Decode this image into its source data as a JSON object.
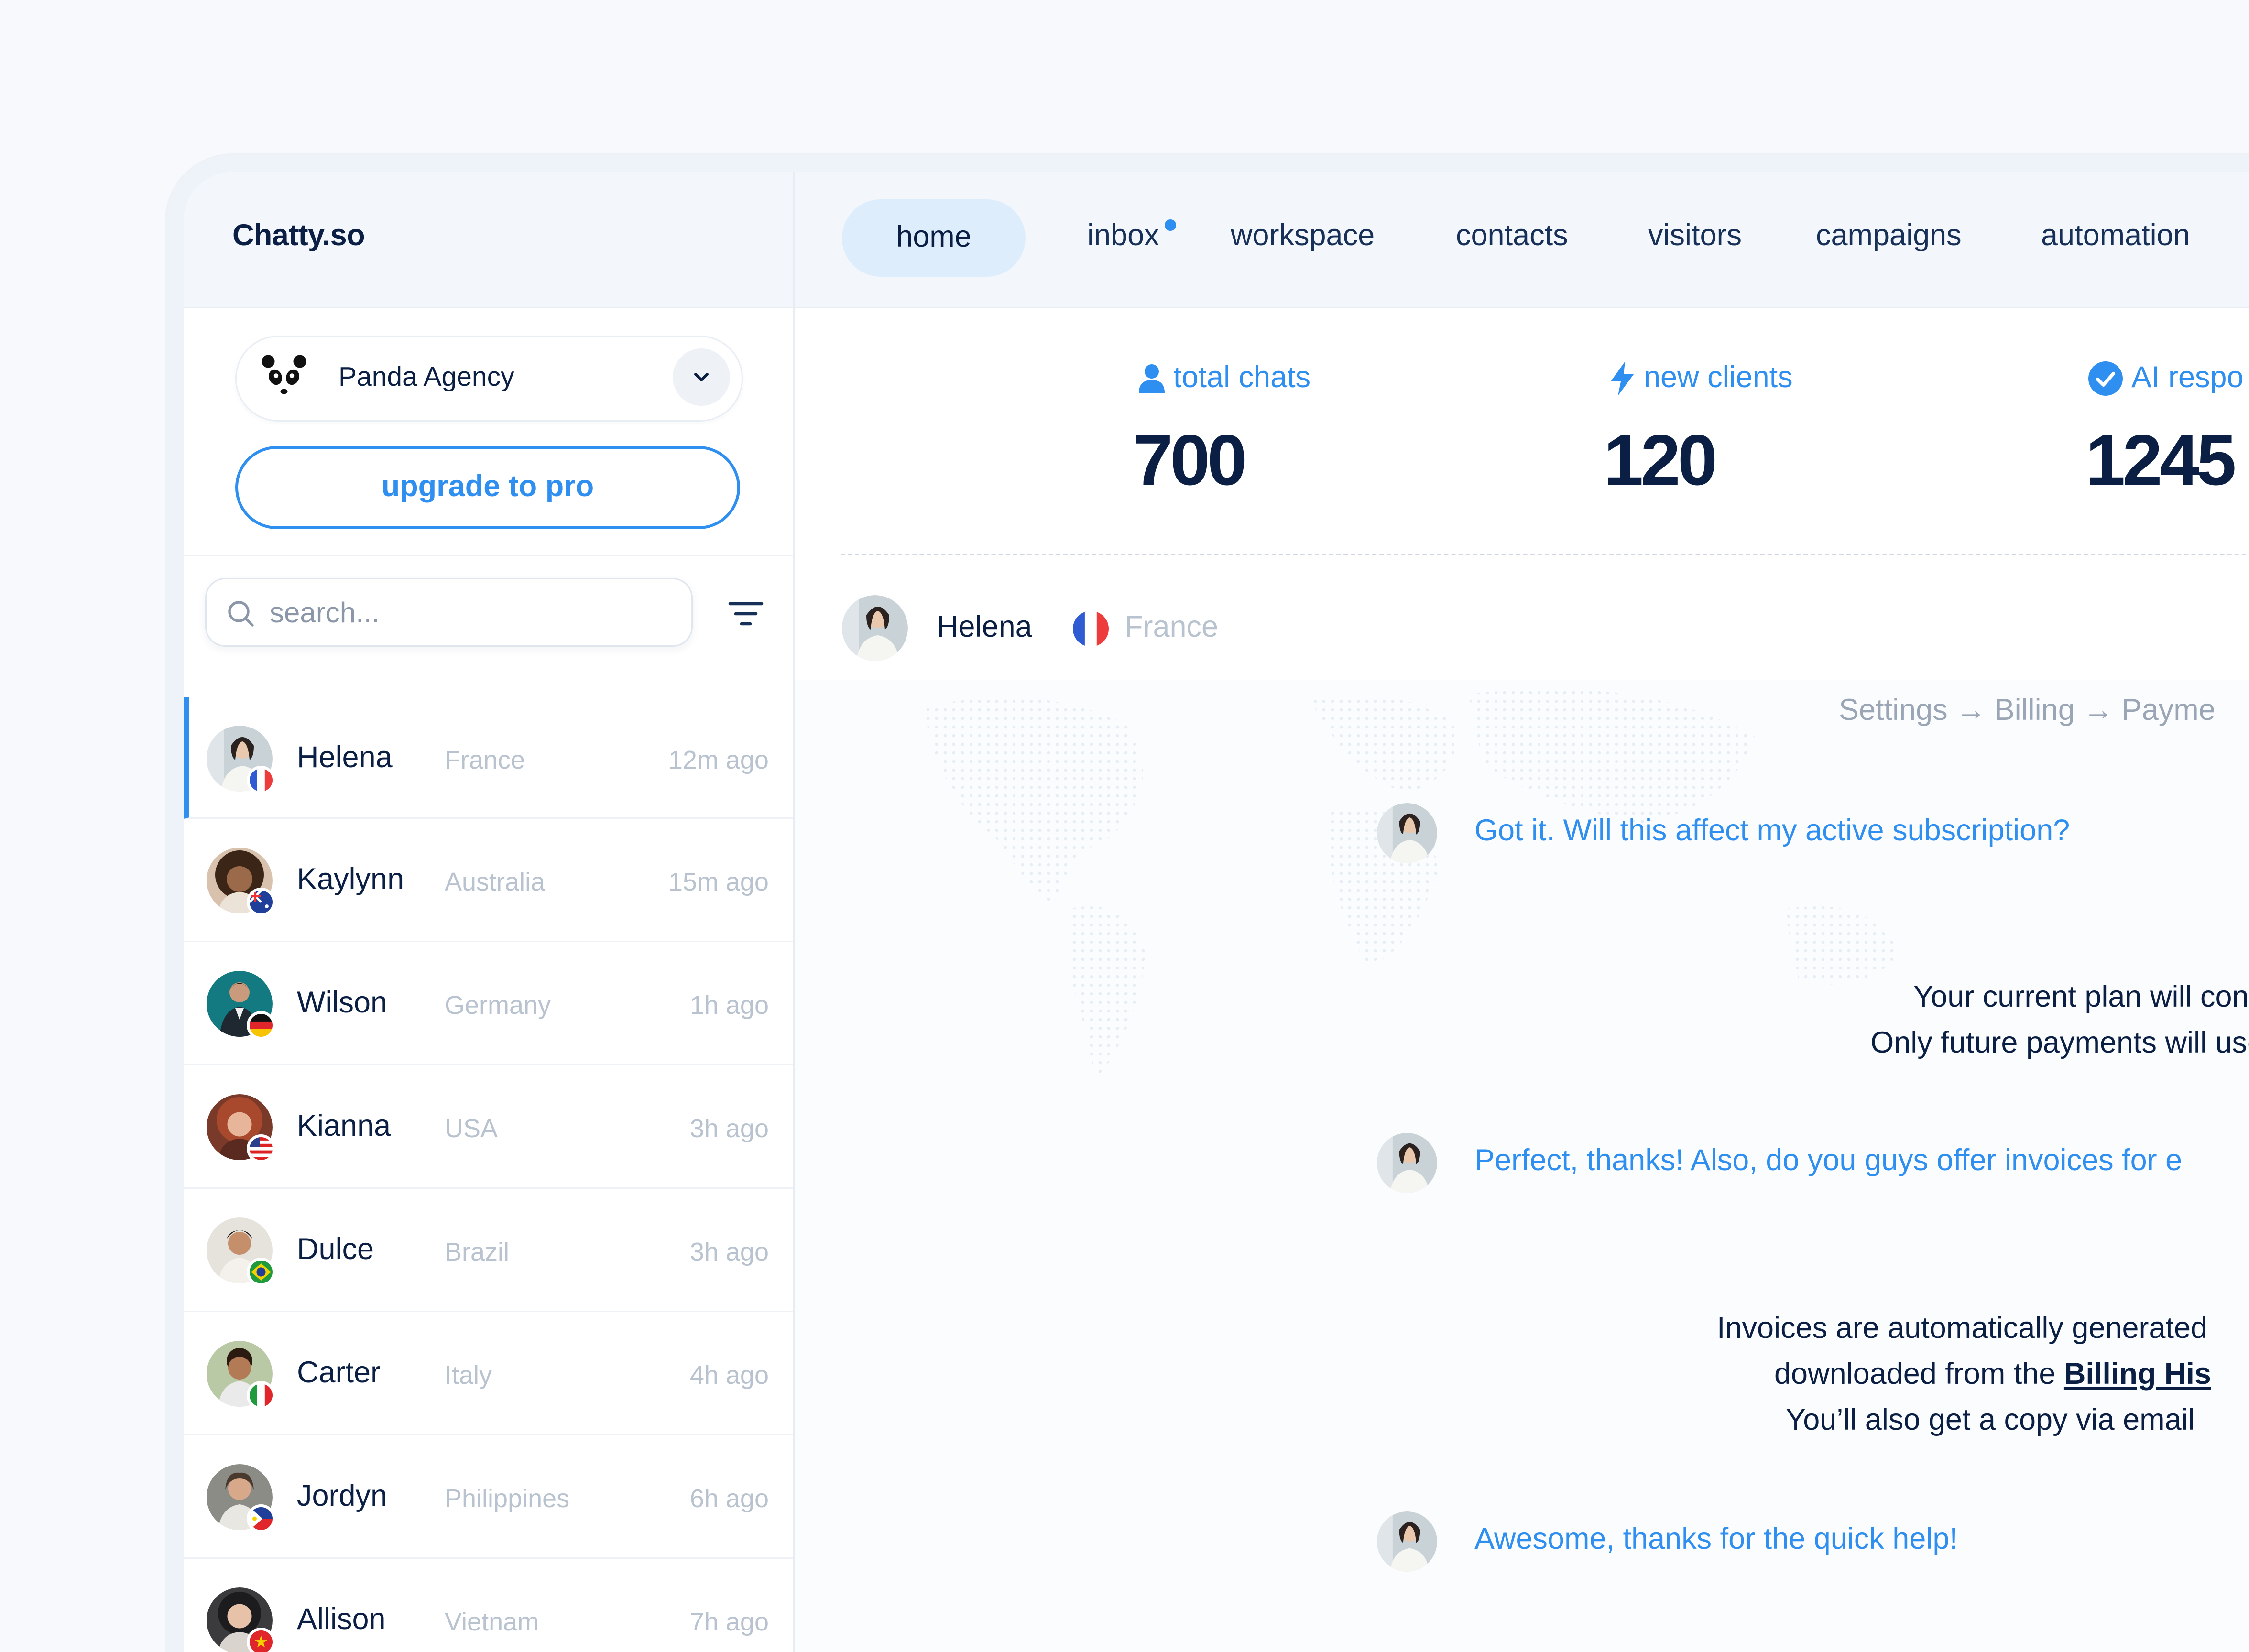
{
  "brand": "Chatty.so",
  "org": {
    "name": "Panda Agency"
  },
  "upgrade_label": "upgrade to pro",
  "search": {
    "placeholder": "search..."
  },
  "nav": {
    "home": "home",
    "inbox": "inbox",
    "workspace": "workspace",
    "contacts": "contacts",
    "visitors": "visitors",
    "campaigns": "campaigns",
    "automation": "automation"
  },
  "stats": [
    {
      "label": "total chats",
      "value": "700",
      "icon": "user-icon"
    },
    {
      "label": "new clients",
      "value": "120",
      "icon": "bolt-icon"
    },
    {
      "label": "AI respo",
      "value": "1245",
      "icon": "check-badge-icon"
    }
  ],
  "contacts": [
    {
      "name": "Helena",
      "country": "France",
      "time": "12m ago"
    },
    {
      "name": "Kaylynn",
      "country": "Australia",
      "time": "15m ago"
    },
    {
      "name": "Wilson",
      "country": "Germany",
      "time": "1h ago"
    },
    {
      "name": "Kianna",
      "country": "USA",
      "time": "3h ago"
    },
    {
      "name": "Dulce",
      "country": "Brazil",
      "time": "3h ago"
    },
    {
      "name": "Carter",
      "country": "Italy",
      "time": "4h ago"
    },
    {
      "name": "Jordyn",
      "country": "Philippines",
      "time": "6h ago"
    },
    {
      "name": "Allison",
      "country": "Vietnam",
      "time": "7h ago"
    }
  ],
  "chat": {
    "name": "Helena",
    "country": "France",
    "breadcrumb": "Settings → Billing → Payme",
    "messages": [
      "Got it. Will this affect my active subscription?",
      "Perfect, thanks! Also, do you guys offer invoices for e",
      "Awesome, thanks for the quick help!"
    ],
    "reply1": [
      "Your current plan will contin",
      "Only future payments will use t"
    ],
    "reply2": {
      "line1": "Invoices are automatically generated",
      "line2_prefix": "downloaded from the ",
      "line2_link": "Billing His",
      "line3": "You’ll also get a copy via email "
    }
  },
  "colors": {
    "accent": "#2e8ff0",
    "text": "#0b1f44",
    "muted": "#b9c3cf"
  }
}
